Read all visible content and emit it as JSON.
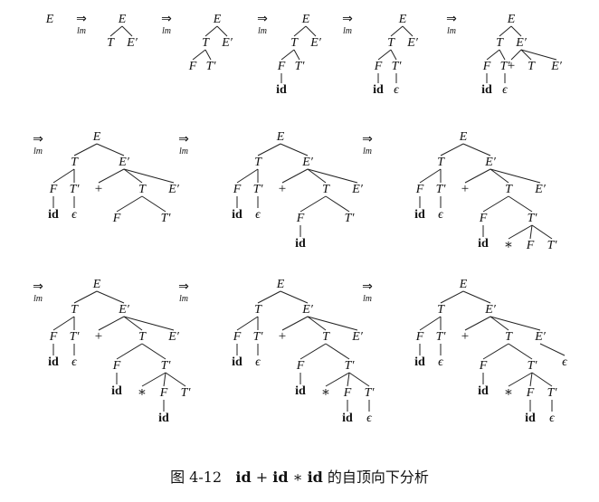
{
  "arrow": {
    "symbol": "⇒",
    "subscript": "lm"
  },
  "caption": {
    "label": "图 4-12",
    "expr_id1": "id",
    "plus": "+",
    "expr_id2": "id",
    "star": "∗",
    "expr_id3": "id",
    "rest": "的自顶向下分析"
  },
  "panels": [
    {
      "nodes": [
        {
          "id": "E",
          "t": "E"
        }
      ],
      "edges": []
    },
    {
      "nodes": [
        {
          "id": "E",
          "t": "E"
        },
        {
          "id": "T",
          "t": "T"
        },
        {
          "id": "Ep",
          "t": "E′"
        }
      ],
      "edges": [
        [
          "E",
          "T"
        ],
        [
          "E",
          "Ep"
        ]
      ]
    },
    {
      "nodes": [
        {
          "id": "E",
          "t": "E"
        },
        {
          "id": "T",
          "t": "T"
        },
        {
          "id": "Ep",
          "t": "E′"
        },
        {
          "id": "F",
          "t": "F"
        },
        {
          "id": "Tp",
          "t": "T′"
        }
      ],
      "edges": [
        [
          "E",
          "T"
        ],
        [
          "E",
          "Ep"
        ],
        [
          "T",
          "F"
        ],
        [
          "T",
          "Tp"
        ]
      ]
    },
    {
      "nodes": [
        {
          "id": "E",
          "t": "E"
        },
        {
          "id": "T",
          "t": "T"
        },
        {
          "id": "Ep",
          "t": "E′"
        },
        {
          "id": "F",
          "t": "F"
        },
        {
          "id": "Tp",
          "t": "T′"
        },
        {
          "id": "id1",
          "t": "id"
        }
      ],
      "edges": [
        [
          "E",
          "T"
        ],
        [
          "E",
          "Ep"
        ],
        [
          "T",
          "F"
        ],
        [
          "T",
          "Tp"
        ],
        [
          "F",
          "id1"
        ]
      ]
    },
    {
      "nodes": [
        {
          "id": "E",
          "t": "E"
        },
        {
          "id": "T",
          "t": "T"
        },
        {
          "id": "Ep",
          "t": "E′"
        },
        {
          "id": "F",
          "t": "F"
        },
        {
          "id": "Tp",
          "t": "T′"
        },
        {
          "id": "id1",
          "t": "id"
        },
        {
          "id": "eps1",
          "t": "ϵ"
        }
      ],
      "edges": [
        [
          "E",
          "T"
        ],
        [
          "E",
          "Ep"
        ],
        [
          "T",
          "F"
        ],
        [
          "T",
          "Tp"
        ],
        [
          "F",
          "id1"
        ],
        [
          "Tp",
          "eps1"
        ]
      ]
    },
    {
      "nodes": [
        {
          "id": "E",
          "t": "E"
        },
        {
          "id": "T",
          "t": "T"
        },
        {
          "id": "Ep",
          "t": "E′"
        },
        {
          "id": "F",
          "t": "F"
        },
        {
          "id": "Tp",
          "t": "T′"
        },
        {
          "id": "id1",
          "t": "id"
        },
        {
          "id": "eps1",
          "t": "ϵ"
        },
        {
          "id": "plus",
          "t": "+"
        },
        {
          "id": "T2",
          "t": "T"
        },
        {
          "id": "Ep2",
          "t": "E′"
        }
      ],
      "edges": [
        [
          "E",
          "T"
        ],
        [
          "E",
          "Ep"
        ],
        [
          "T",
          "F"
        ],
        [
          "T",
          "Tp"
        ],
        [
          "F",
          "id1"
        ],
        [
          "Tp",
          "eps1"
        ],
        [
          "Ep",
          "plus"
        ],
        [
          "Ep",
          "T2"
        ],
        [
          "Ep",
          "Ep2"
        ]
      ]
    },
    {
      "nodes": [
        {
          "id": "E",
          "t": "E"
        },
        {
          "id": "T",
          "t": "T"
        },
        {
          "id": "Ep",
          "t": "E′"
        },
        {
          "id": "F",
          "t": "F"
        },
        {
          "id": "Tp",
          "t": "T′"
        },
        {
          "id": "id1",
          "t": "id"
        },
        {
          "id": "eps1",
          "t": "ϵ"
        },
        {
          "id": "plus",
          "t": "+"
        },
        {
          "id": "T2",
          "t": "T"
        },
        {
          "id": "Ep2",
          "t": "E′"
        },
        {
          "id": "F2",
          "t": "F"
        },
        {
          "id": "Tp2",
          "t": "T′"
        }
      ],
      "edges": [
        [
          "E",
          "T"
        ],
        [
          "E",
          "Ep"
        ],
        [
          "T",
          "F"
        ],
        [
          "T",
          "Tp"
        ],
        [
          "F",
          "id1"
        ],
        [
          "Tp",
          "eps1"
        ],
        [
          "Ep",
          "plus"
        ],
        [
          "Ep",
          "T2"
        ],
        [
          "Ep",
          "Ep2"
        ],
        [
          "T2",
          "F2"
        ],
        [
          "T2",
          "Tp2"
        ]
      ]
    },
    {
      "nodes": [
        {
          "id": "E",
          "t": "E"
        },
        {
          "id": "T",
          "t": "T"
        },
        {
          "id": "Ep",
          "t": "E′"
        },
        {
          "id": "F",
          "t": "F"
        },
        {
          "id": "Tp",
          "t": "T′"
        },
        {
          "id": "id1",
          "t": "id"
        },
        {
          "id": "eps1",
          "t": "ϵ"
        },
        {
          "id": "plus",
          "t": "+"
        },
        {
          "id": "T2",
          "t": "T"
        },
        {
          "id": "Ep2",
          "t": "E′"
        },
        {
          "id": "F2",
          "t": "F"
        },
        {
          "id": "Tp2",
          "t": "T′"
        },
        {
          "id": "id2",
          "t": "id"
        }
      ],
      "edges": [
        [
          "E",
          "T"
        ],
        [
          "E",
          "Ep"
        ],
        [
          "T",
          "F"
        ],
        [
          "T",
          "Tp"
        ],
        [
          "F",
          "id1"
        ],
        [
          "Tp",
          "eps1"
        ],
        [
          "Ep",
          "plus"
        ],
        [
          "Ep",
          "T2"
        ],
        [
          "Ep",
          "Ep2"
        ],
        [
          "T2",
          "F2"
        ],
        [
          "T2",
          "Tp2"
        ],
        [
          "F2",
          "id2"
        ]
      ]
    },
    {
      "nodes": [
        {
          "id": "E",
          "t": "E"
        },
        {
          "id": "T",
          "t": "T"
        },
        {
          "id": "Ep",
          "t": "E′"
        },
        {
          "id": "F",
          "t": "F"
        },
        {
          "id": "Tp",
          "t": "T′"
        },
        {
          "id": "id1",
          "t": "id"
        },
        {
          "id": "eps1",
          "t": "ϵ"
        },
        {
          "id": "plus",
          "t": "+"
        },
        {
          "id": "T2",
          "t": "T"
        },
        {
          "id": "Ep2",
          "t": "E′"
        },
        {
          "id": "F2",
          "t": "F"
        },
        {
          "id": "Tp2",
          "t": "T′"
        },
        {
          "id": "id2",
          "t": "id"
        },
        {
          "id": "star",
          "t": "∗"
        },
        {
          "id": "F3",
          "t": "F"
        },
        {
          "id": "Tp3",
          "t": "T′"
        }
      ],
      "edges": [
        [
          "E",
          "T"
        ],
        [
          "E",
          "Ep"
        ],
        [
          "T",
          "F"
        ],
        [
          "T",
          "Tp"
        ],
        [
          "F",
          "id1"
        ],
        [
          "Tp",
          "eps1"
        ],
        [
          "Ep",
          "plus"
        ],
        [
          "Ep",
          "T2"
        ],
        [
          "Ep",
          "Ep2"
        ],
        [
          "T2",
          "F2"
        ],
        [
          "T2",
          "Tp2"
        ],
        [
          "F2",
          "id2"
        ],
        [
          "Tp2",
          "star"
        ],
        [
          "Tp2",
          "F3"
        ],
        [
          "Tp2",
          "Tp3"
        ]
      ]
    },
    {
      "nodes": [
        {
          "id": "E",
          "t": "E"
        },
        {
          "id": "T",
          "t": "T"
        },
        {
          "id": "Ep",
          "t": "E′"
        },
        {
          "id": "F",
          "t": "F"
        },
        {
          "id": "Tp",
          "t": "T′"
        },
        {
          "id": "id1",
          "t": "id"
        },
        {
          "id": "eps1",
          "t": "ϵ"
        },
        {
          "id": "plus",
          "t": "+"
        },
        {
          "id": "T2",
          "t": "T"
        },
        {
          "id": "Ep2",
          "t": "E′"
        },
        {
          "id": "F2",
          "t": "F"
        },
        {
          "id": "Tp2",
          "t": "T′"
        },
        {
          "id": "id2",
          "t": "id"
        },
        {
          "id": "star",
          "t": "∗"
        },
        {
          "id": "F3",
          "t": "F"
        },
        {
          "id": "Tp3",
          "t": "T′"
        },
        {
          "id": "id3",
          "t": "id"
        }
      ],
      "edges": [
        [
          "E",
          "T"
        ],
        [
          "E",
          "Ep"
        ],
        [
          "T",
          "F"
        ],
        [
          "T",
          "Tp"
        ],
        [
          "F",
          "id1"
        ],
        [
          "Tp",
          "eps1"
        ],
        [
          "Ep",
          "plus"
        ],
        [
          "Ep",
          "T2"
        ],
        [
          "Ep",
          "Ep2"
        ],
        [
          "T2",
          "F2"
        ],
        [
          "T2",
          "Tp2"
        ],
        [
          "F2",
          "id2"
        ],
        [
          "Tp2",
          "star"
        ],
        [
          "Tp2",
          "F3"
        ],
        [
          "Tp2",
          "Tp3"
        ],
        [
          "F3",
          "id3"
        ]
      ]
    },
    {
      "nodes": [
        {
          "id": "E",
          "t": "E"
        },
        {
          "id": "T",
          "t": "T"
        },
        {
          "id": "Ep",
          "t": "E′"
        },
        {
          "id": "F",
          "t": "F"
        },
        {
          "id": "Tp",
          "t": "T′"
        },
        {
          "id": "id1",
          "t": "id"
        },
        {
          "id": "eps1",
          "t": "ϵ"
        },
        {
          "id": "plus",
          "t": "+"
        },
        {
          "id": "T2",
          "t": "T"
        },
        {
          "id": "Ep2",
          "t": "E′"
        },
        {
          "id": "F2",
          "t": "F"
        },
        {
          "id": "Tp2",
          "t": "T′"
        },
        {
          "id": "id2",
          "t": "id"
        },
        {
          "id": "star",
          "t": "∗"
        },
        {
          "id": "F3",
          "t": "F"
        },
        {
          "id": "Tp3",
          "t": "T′"
        },
        {
          "id": "id3",
          "t": "id"
        },
        {
          "id": "eps2",
          "t": "ϵ"
        }
      ],
      "edges": [
        [
          "E",
          "T"
        ],
        [
          "E",
          "Ep"
        ],
        [
          "T",
          "F"
        ],
        [
          "T",
          "Tp"
        ],
        [
          "F",
          "id1"
        ],
        [
          "Tp",
          "eps1"
        ],
        [
          "Ep",
          "plus"
        ],
        [
          "Ep",
          "T2"
        ],
        [
          "Ep",
          "Ep2"
        ],
        [
          "T2",
          "F2"
        ],
        [
          "T2",
          "Tp2"
        ],
        [
          "F2",
          "id2"
        ],
        [
          "Tp2",
          "star"
        ],
        [
          "Tp2",
          "F3"
        ],
        [
          "Tp2",
          "Tp3"
        ],
        [
          "F3",
          "id3"
        ],
        [
          "Tp3",
          "eps2"
        ]
      ]
    },
    {
      "nodes": [
        {
          "id": "E",
          "t": "E"
        },
        {
          "id": "T",
          "t": "T"
        },
        {
          "id": "Ep",
          "t": "E′"
        },
        {
          "id": "F",
          "t": "F"
        },
        {
          "id": "Tp",
          "t": "T′"
        },
        {
          "id": "id1",
          "t": "id"
        },
        {
          "id": "eps1",
          "t": "ϵ"
        },
        {
          "id": "plus",
          "t": "+"
        },
        {
          "id": "T2",
          "t": "T"
        },
        {
          "id": "Ep2",
          "t": "E′"
        },
        {
          "id": "F2",
          "t": "F"
        },
        {
          "id": "Tp2",
          "t": "T′"
        },
        {
          "id": "id2",
          "t": "id"
        },
        {
          "id": "star",
          "t": "∗"
        },
        {
          "id": "F3",
          "t": "F"
        },
        {
          "id": "Tp3",
          "t": "T′"
        },
        {
          "id": "id3",
          "t": "id"
        },
        {
          "id": "eps2",
          "t": "ϵ"
        },
        {
          "id": "eps3",
          "t": "ϵ"
        }
      ],
      "edges": [
        [
          "E",
          "T"
        ],
        [
          "E",
          "Ep"
        ],
        [
          "T",
          "F"
        ],
        [
          "T",
          "Tp"
        ],
        [
          "F",
          "id1"
        ],
        [
          "Tp",
          "eps1"
        ],
        [
          "Ep",
          "plus"
        ],
        [
          "Ep",
          "T2"
        ],
        [
          "Ep",
          "Ep2"
        ],
        [
          "T2",
          "F2"
        ],
        [
          "T2",
          "Tp2"
        ],
        [
          "F2",
          "id2"
        ],
        [
          "Tp2",
          "star"
        ],
        [
          "Tp2",
          "F3"
        ],
        [
          "Tp2",
          "Tp3"
        ],
        [
          "F3",
          "id3"
        ],
        [
          "Tp3",
          "eps2"
        ],
        [
          "Ep2",
          "eps3"
        ]
      ]
    }
  ]
}
